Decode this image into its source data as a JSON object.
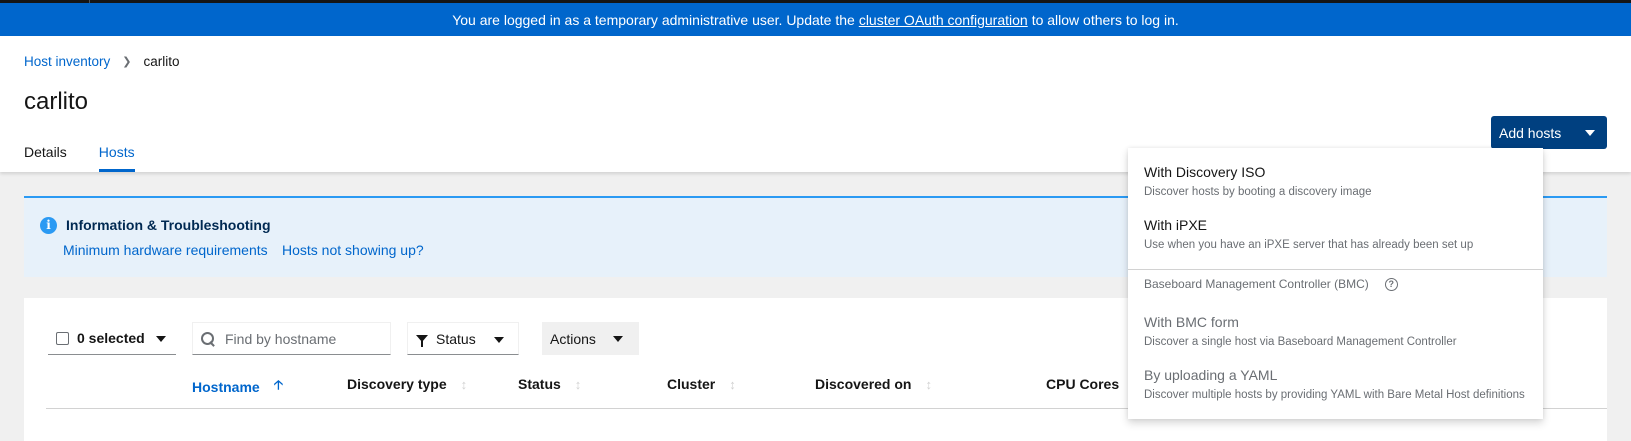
{
  "banner": {
    "text_before": "You are logged in as a temporary administrative user. Update the",
    "link": "cluster OAuth configuration",
    "text_after": "to allow others to log in."
  },
  "breadcrumb": {
    "parent": "Host inventory",
    "current": "carlito"
  },
  "page": {
    "title": "carlito"
  },
  "tabs": [
    {
      "label": "Details",
      "active": false
    },
    {
      "label": "Hosts",
      "active": true
    }
  ],
  "add_hosts": {
    "label": "Add hosts"
  },
  "alert": {
    "title": "Information & Troubleshooting",
    "link1": "Minimum hardware requirements",
    "link2": "Hosts not showing up?"
  },
  "toolbar": {
    "selected_label": "0 selected",
    "search_placeholder": "Find by hostname",
    "status_filter": "Status",
    "actions": "Actions"
  },
  "table": {
    "columns": [
      {
        "label": "Hostname",
        "sorted": true
      },
      {
        "label": "Discovery type"
      },
      {
        "label": "Status"
      },
      {
        "label": "Cluster"
      },
      {
        "label": "Discovered on"
      },
      {
        "label": "CPU Cores"
      }
    ]
  },
  "menu": {
    "items": [
      {
        "title": "With Discovery ISO",
        "desc": "Discover hosts by booting a discovery image",
        "disabled": false
      },
      {
        "title": "With iPXE",
        "desc": "Use when you have an iPXE server that has already been set up",
        "disabled": false
      }
    ],
    "group_label": "Baseboard Management Controller (BMC)",
    "bmc_items": [
      {
        "title": "With BMC form",
        "desc": "Discover a single host via Baseboard Management Controller",
        "disabled": true
      },
      {
        "title": "By uploading a YAML",
        "desc": "Discover multiple hosts by providing YAML with Bare Metal Host definitions",
        "disabled": true
      }
    ]
  },
  "colors": {
    "primary": "#0066cc",
    "primary_dark": "#004080",
    "alert_bg": "#e7f1fa",
    "info": "#2b9af3"
  }
}
